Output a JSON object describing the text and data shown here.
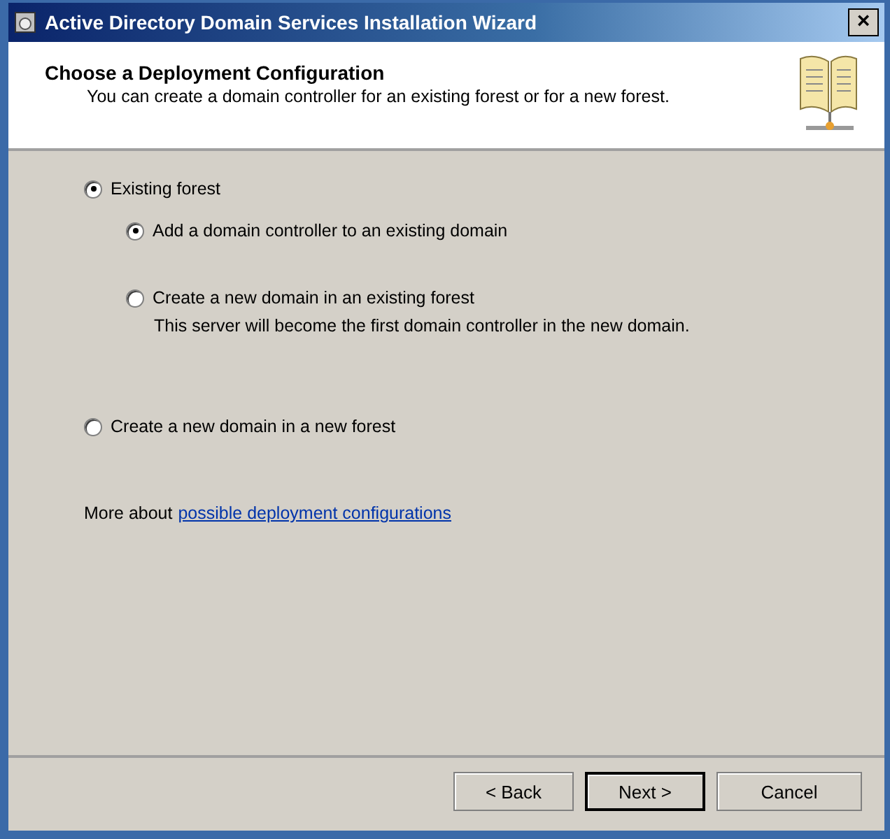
{
  "window": {
    "title": "Active Directory Domain Services Installation Wizard",
    "close": "×"
  },
  "header": {
    "title": "Choose a Deployment Configuration",
    "subtitle": "You can create a domain controller for an existing forest or for a new forest."
  },
  "options": [
    {
      "label": "Existing forest",
      "selected": true,
      "children": [
        {
          "label": "Add a domain controller to an existing domain",
          "selected": true
        },
        {
          "label": "Create a new domain in an existing forest",
          "selected": false,
          "description": "This server will become the first domain controller in the new domain."
        }
      ]
    },
    {
      "label": "Create a new domain in a new forest",
      "selected": false
    }
  ],
  "more_about": {
    "text": "More about",
    "link": "possible deployment configurations"
  },
  "buttons": [
    {
      "label": "< Back",
      "default": false
    },
    {
      "label": "Next >",
      "default": true
    },
    {
      "label": "Cancel",
      "default": false
    }
  ]
}
